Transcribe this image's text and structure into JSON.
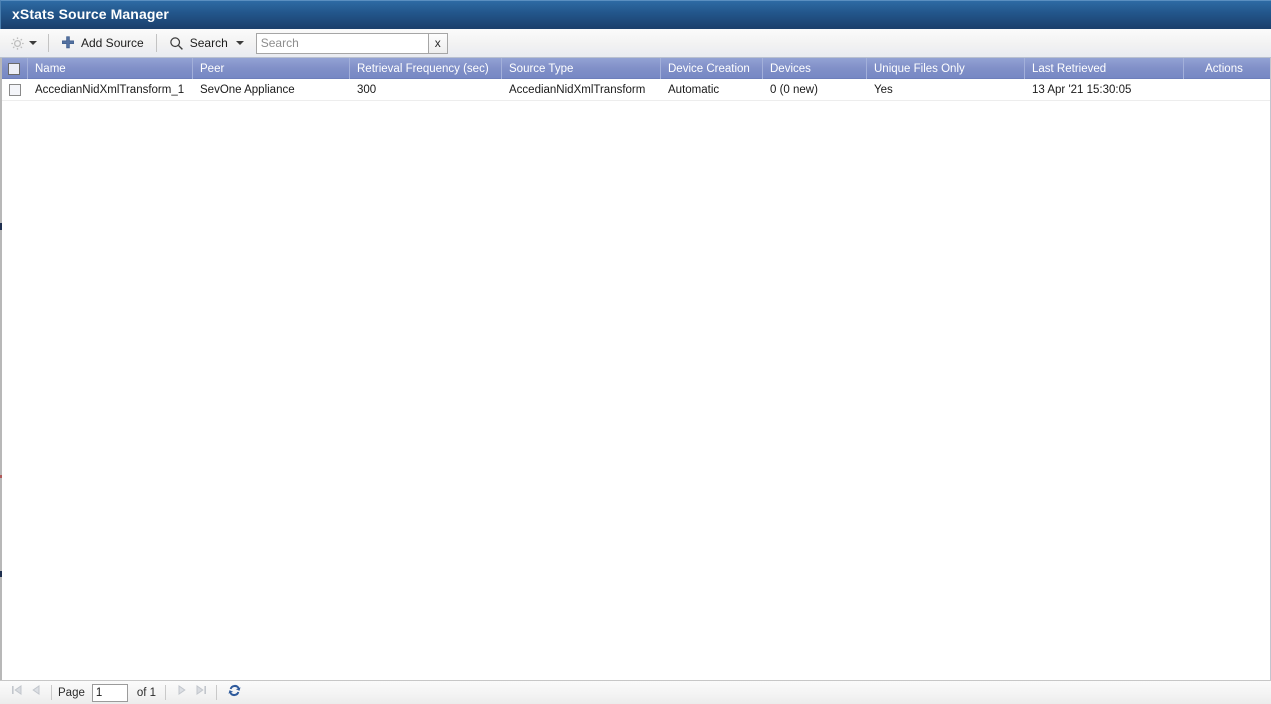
{
  "window": {
    "title": "xStats Source Manager",
    "title_bar_color": "#1b3f6b"
  },
  "toolbar": {
    "gear_icon": "gear-icon",
    "gear_caret_icon": "chevron-down-icon",
    "add_source_label": "Add Source",
    "add_source_icon": "plus-icon",
    "search_menu_label": "Search",
    "search_menu_icon": "magnifier-icon",
    "search_menu_caret_icon": "chevron-down-icon",
    "search_placeholder": "Search",
    "search_value": "",
    "search_clear_label": "x",
    "accent_color": "#53709f"
  },
  "grid": {
    "select_all_checkbox": "unchecked",
    "columns": [
      {
        "key": "check",
        "label": ""
      },
      {
        "key": "name",
        "label": "Name"
      },
      {
        "key": "peer",
        "label": "Peer"
      },
      {
        "key": "freq",
        "label": "Retrieval Frequency (sec)"
      },
      {
        "key": "stype",
        "label": "Source Type"
      },
      {
        "key": "dcre",
        "label": "Device Creation"
      },
      {
        "key": "dev",
        "label": "Devices"
      },
      {
        "key": "uniq",
        "label": "Unique Files Only"
      },
      {
        "key": "last",
        "label": "Last Retrieved"
      },
      {
        "key": "act",
        "label": "Actions"
      }
    ],
    "header_color": "#8190c8",
    "rows": [
      {
        "selected": false,
        "name": "AccedianNidXmlTransform_1",
        "peer": "SevOne Appliance",
        "freq": "300",
        "stype": "AccedianNidXmlTransform",
        "dcre": "Automatic",
        "dev": "0 (0 new)",
        "uniq": "Yes",
        "last": "13 Apr '21 15:30:05",
        "act": ""
      }
    ]
  },
  "pager": {
    "first_icon": "first-page-icon",
    "prev_icon": "previous-page-icon",
    "page_label": "Page",
    "page_value": "1",
    "of_label": "of 1",
    "next_icon": "next-page-icon",
    "last_icon": "last-page-icon",
    "refresh_icon": "refresh-icon",
    "nav_disabled_color": "#c2c6cc",
    "refresh_color": "#2e5a9c"
  }
}
